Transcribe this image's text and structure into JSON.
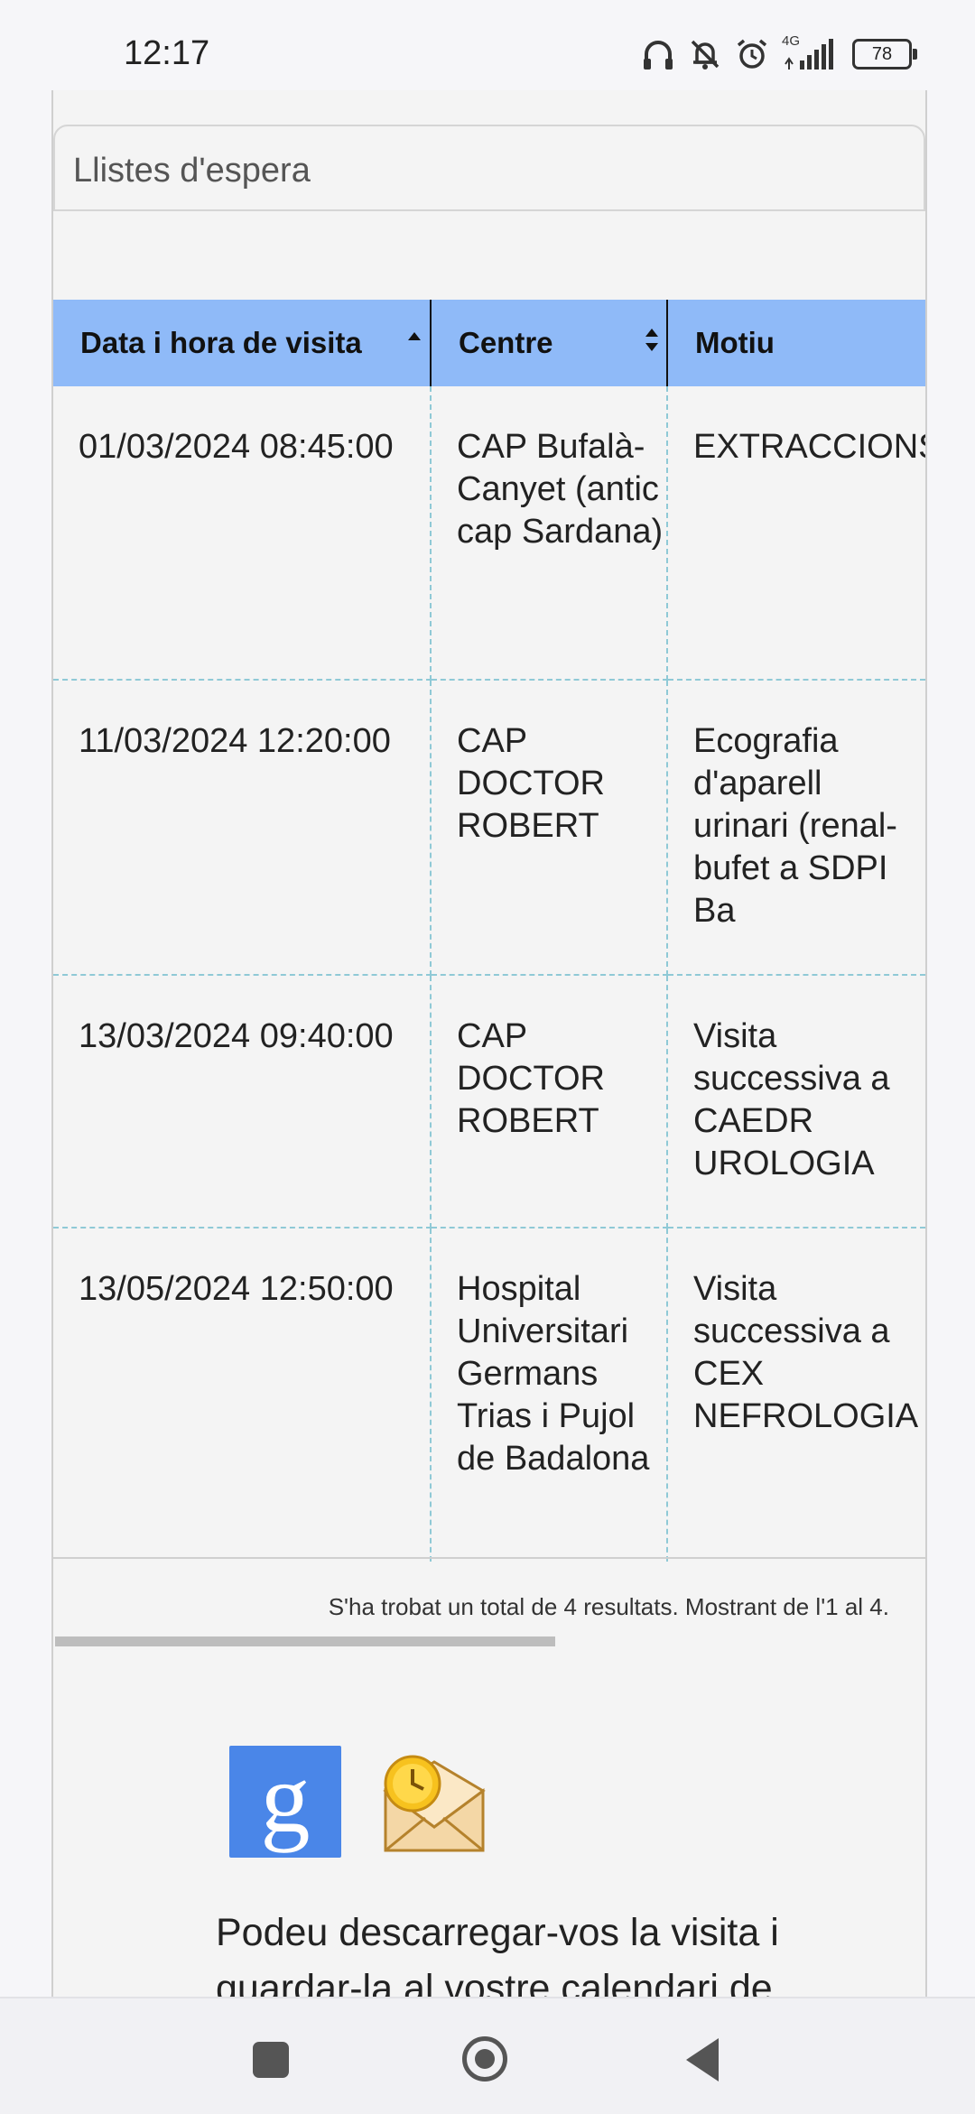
{
  "status_bar": {
    "time": "12:17",
    "network": "4G",
    "battery": "78"
  },
  "section": {
    "title": "Llistes d'espera"
  },
  "table": {
    "columns": [
      "Data i hora de visita",
      "Centre",
      "Motiu"
    ],
    "rows": [
      {
        "date": "01/03/2024 08:45:00",
        "center": "CAP Bufalà-Canyet (antic cap Sardana)",
        "reason": "EXTRACCIONS"
      },
      {
        "date": "11/03/2024 12:20:00",
        "center": "CAP DOCTOR ROBERT",
        "reason": "Ecografia d'aparell urinari (renal-bufet a SDPI Ba"
      },
      {
        "date": "13/03/2024 09:40:00",
        "center": "CAP DOCTOR ROBERT",
        "reason": "Visita successiva a CAEDR UROLOGIA"
      },
      {
        "date": "13/05/2024 12:50:00",
        "center": "Hospital Universitari Germans Trias i Pujol de Badalona",
        "reason": "Visita successiva a CEX NEFROLOGIA"
      }
    ],
    "footer": "S'ha trobat un total de 4 resultats. Mostrant de l'1 al 4."
  },
  "download": {
    "google_letter": "g",
    "text": "Podeu descarregar-vos la visita i guardar-la al vostre calendari de"
  },
  "colors": {
    "header_bg": "#8fbaf8",
    "row_divider": "#8fc9d6",
    "google_blue": "#4a86e8"
  }
}
